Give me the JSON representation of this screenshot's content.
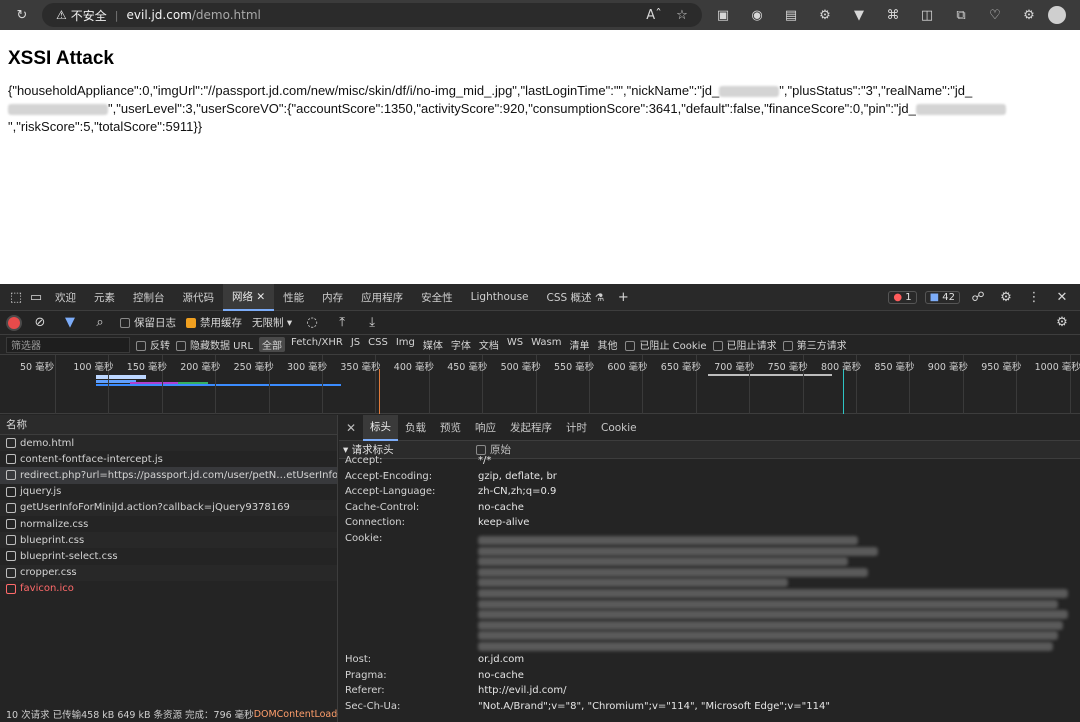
{
  "browser": {
    "security_label": "不安全",
    "url_host": "evil.jd.com",
    "url_path": "/demo.html"
  },
  "page": {
    "title": "XSSI Attack",
    "json_part1": "{\"householdAppliance\":0,\"imgUrl\":\"//passport.jd.com/new/misc/skin/df/i/no-img_mid_.jpg\",\"lastLoginTime\":\"\",\"nickName\":\"jd_",
    "json_part2": "\",\"plusStatus\":\"3\",\"realName\":\"jd_",
    "json_part3": "\",\"userLevel\":3,\"userScoreVO\":{\"accountScore\":1350,\"activityScore\":920,\"consumptionScore\":3641,\"default\":false,\"financeScore\":0,\"pin\":\"jd_",
    "json_part4": "\",\"riskScore\":5,\"totalScore\":5911}}"
  },
  "devtools": {
    "tabs": [
      "欢迎",
      "元素",
      "控制台",
      "源代码",
      "网络",
      "性能",
      "内存",
      "应用程序",
      "安全性",
      "Lighthouse",
      "CSS 概述 ⚗"
    ],
    "active_tab": "网络",
    "error_count": "1",
    "message_count": "42",
    "toolbar": {
      "preserve_log": "保留日志",
      "disable_cache": "禁用缓存",
      "throttle": "无限制"
    },
    "filter": {
      "placeholder": "筛选器",
      "invert": "反转",
      "hide_data_urls": "隐藏数据 URL",
      "types": [
        "全部",
        "Fetch/XHR",
        "JS",
        "CSS",
        "Img",
        "媒体",
        "字体",
        "文档",
        "WS",
        "Wasm",
        "清单",
        "其他"
      ],
      "blocked_cookies": "已阻止 Cookie",
      "blocked_requests": "已阻止请求",
      "third_party": "第三方请求"
    },
    "timeline_ticks": [
      "50 毫秒",
      "100 毫秒",
      "150 毫秒",
      "200 毫秒",
      "250 毫秒",
      "300 毫秒",
      "350 毫秒",
      "400 毫秒",
      "450 毫秒",
      "500 毫秒",
      "550 毫秒",
      "600 毫秒",
      "650 毫秒",
      "700 毫秒",
      "750 毫秒",
      "800 毫秒",
      "850 毫秒",
      "900 毫秒",
      "950 毫秒",
      "1000 毫秒"
    ],
    "name_header": "名称",
    "requests": [
      "demo.html",
      "content-fontface-intercept.js",
      "redirect.php?url=https://passport.jd.com/user/petN…etUserInfoForMiniJd…",
      "jquery.js",
      "getUserInfoForMiniJd.action?callback=jQuery9378169",
      "normalize.css",
      "blueprint.css",
      "blueprint-select.css",
      "cropper.css",
      "favicon.ico"
    ],
    "status_bar": "10 次请求  已传输458 kB  649 kB 条资源  完成：796 毫秒  ",
    "status_dcl": "DOMContentLoaded",
    "detail_tabs": [
      "标头",
      "负载",
      "预览",
      "响应",
      "发起程序",
      "计时",
      "Cookie"
    ],
    "section_title": "▾ 请求标头",
    "raw_label": "原始",
    "headers": [
      {
        "name": "Accept:",
        "value": "*/*"
      },
      {
        "name": "Accept-Encoding:",
        "value": "gzip, deflate, br"
      },
      {
        "name": "Accept-Language:",
        "value": "zh-CN,zh;q=0.9"
      },
      {
        "name": "Cache-Control:",
        "value": "no-cache"
      },
      {
        "name": "Connection:",
        "value": "keep-alive"
      },
      {
        "name": "Cookie:",
        "value": ""
      },
      {
        "name": "Host:",
        "value": "or.jd.com"
      },
      {
        "name": "Pragma:",
        "value": "no-cache"
      },
      {
        "name": "Referer:",
        "value": "http://evil.jd.com/"
      },
      {
        "name": "Sec-Ch-Ua:",
        "value": "\"Not.A/Brand\";v=\"8\", \"Chromium\";v=\"114\", \"Microsoft Edge\";v=\"114\""
      }
    ]
  }
}
